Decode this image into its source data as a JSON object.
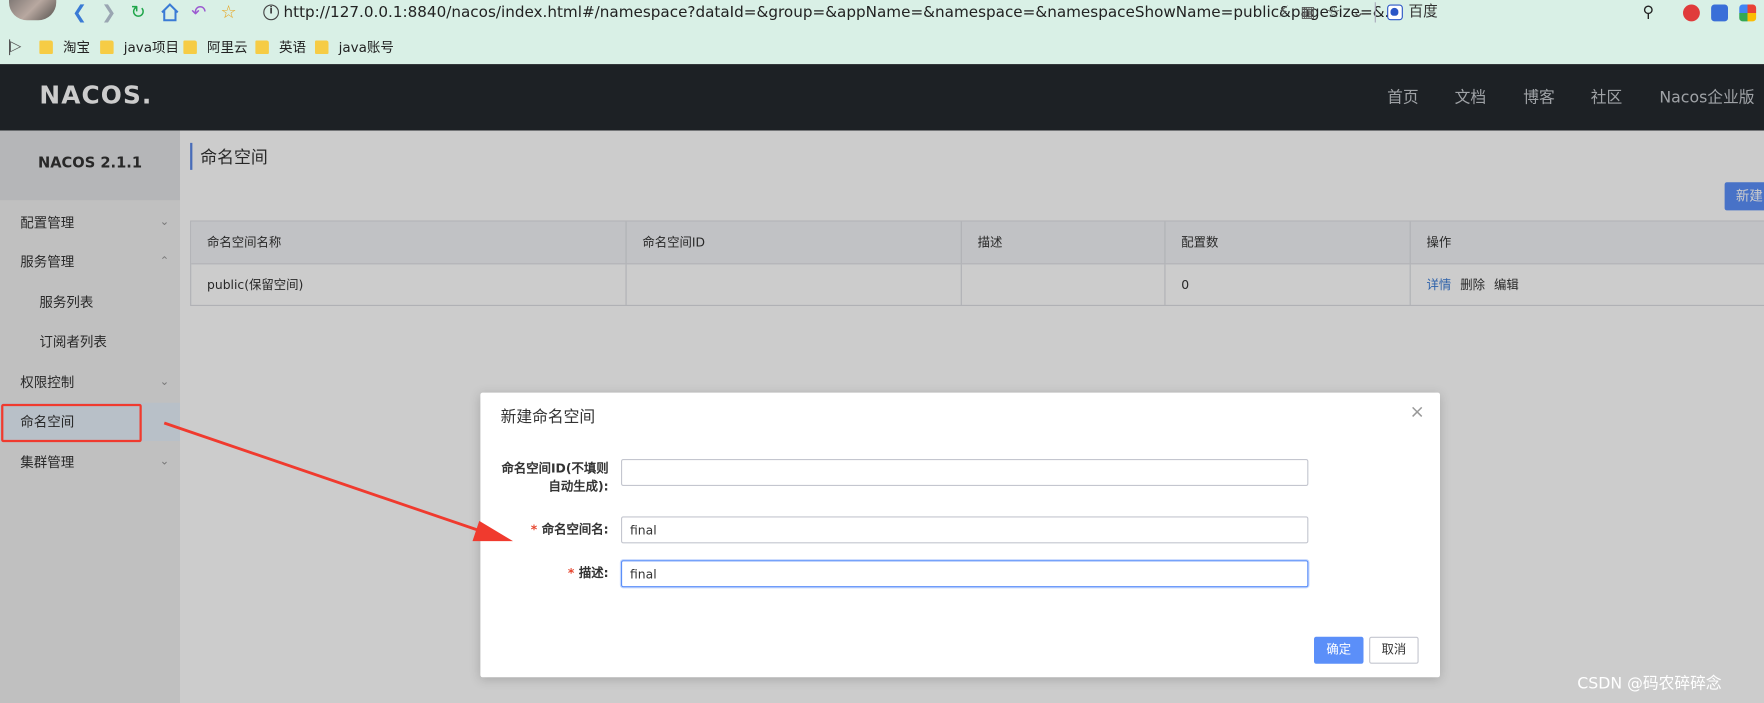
{
  "browser": {
    "url": "http://127.0.0.1:8840/nacos/index.html#/namespace?dataId=&group=&appName=&namespace=&namespaceShowName=public&pageSize=&...",
    "search_engine_label": "百度",
    "bookmarks": [
      "淘宝",
      "java项目",
      "阿里云",
      "英语",
      "java账号"
    ]
  },
  "app": {
    "logo": "NACOS.",
    "nav": [
      "首页",
      "文档",
      "博客",
      "社区",
      "Nacos企业版"
    ],
    "version": "NACOS 2.1.1"
  },
  "sidebar": {
    "items": [
      {
        "label": "配置管理",
        "caret": "down"
      },
      {
        "label": "服务管理",
        "caret": "up"
      },
      {
        "label": "服务列表",
        "caret": ""
      },
      {
        "label": "订阅者列表",
        "caret": ""
      },
      {
        "label": "权限控制",
        "caret": "down"
      },
      {
        "label": "命名空间",
        "caret": ""
      },
      {
        "label": "集群管理",
        "caret": "down"
      }
    ]
  },
  "main": {
    "title": "命名空间",
    "new_button_label": "新建",
    "table": {
      "headers": [
        "命名空间名称",
        "命名空间ID",
        "描述",
        "配置数",
        "操作"
      ],
      "rows": [
        {
          "name": "public(保留空间)",
          "id": "",
          "desc": "",
          "count": "0",
          "ops": [
            "详情",
            "删除",
            "编辑"
          ]
        }
      ]
    }
  },
  "dialog": {
    "title": "新建命名空间",
    "close_glyph": "×",
    "fields": {
      "id_label_line1": "命名空间ID(不填则",
      "id_label_line2": "自动生成):",
      "id_value": "",
      "name_label": "命名空间名:",
      "name_value": "final",
      "desc_label": "描述:",
      "desc_value": "final",
      "required_mark": "*"
    },
    "ok_label": "确定",
    "cancel_label": "取消"
  },
  "watermark": "CSDN @码农碎碎念",
  "colors": {
    "primary": "#5b8ff9",
    "annotation_red": "#f03a2e",
    "topnav_bg": "#252a2f",
    "browser_bg": "#d9f0e6"
  }
}
